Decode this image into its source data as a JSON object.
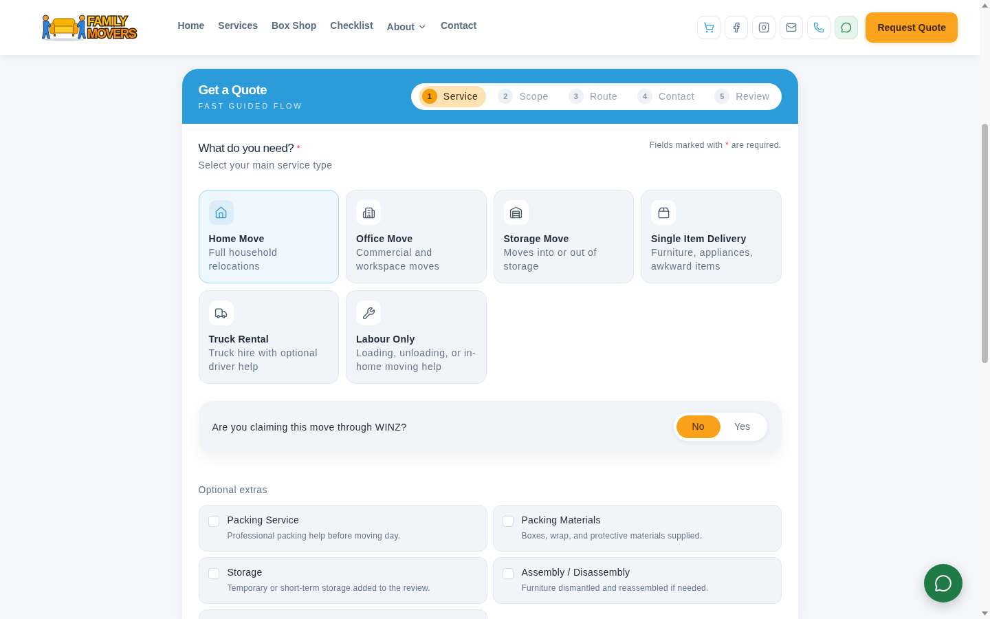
{
  "header": {
    "logo": {
      "line_1": "FAMILY",
      "line_2": "MOVERS"
    },
    "nav": [
      {
        "label": "Home",
        "kind": "link"
      },
      {
        "label": "Services",
        "kind": "link"
      },
      {
        "label": "Box Shop",
        "kind": "link"
      },
      {
        "label": "Checklist",
        "kind": "link"
      },
      {
        "label": "About",
        "kind": "dropdown"
      },
      {
        "label": "Contact",
        "kind": "link"
      }
    ],
    "cta": "Request Quote"
  },
  "quote": {
    "title": "Get a Quote",
    "subtitle": "FAST GUIDED FLOW",
    "steps": [
      {
        "number": "1",
        "label": "Service",
        "selected": true
      },
      {
        "number": "2",
        "label": "Scope",
        "selected": false
      },
      {
        "number": "3",
        "label": "Route",
        "selected": false
      },
      {
        "number": "4",
        "label": "Contact",
        "selected": false
      },
      {
        "number": "5",
        "label": "Review",
        "selected": false
      }
    ],
    "question": {
      "title": "What do you need?",
      "required_mark": "*",
      "hint": "Select your main service type"
    },
    "required_note": {
      "before": "Fields marked with",
      "mark": "*",
      "after": "are required."
    },
    "services": [
      {
        "title": "Home Move",
        "description": "Full household relocations",
        "selected": true
      },
      {
        "title": "Office Move",
        "description": "Commercial and workspace moves",
        "selected": false
      },
      {
        "title": "Storage Move",
        "description": "Moves into or out of storage",
        "selected": false
      },
      {
        "title": "Single Item Delivery",
        "description": "Furniture, appliances, awkward items",
        "selected": false
      },
      {
        "title": "Truck Rental",
        "description": "Truck hire with optional driver help",
        "selected": false
      },
      {
        "title": "Labour Only",
        "description": "Loading, unloading, or in-home moving help",
        "selected": false
      }
    ],
    "winz": {
      "question": "Are you claiming this move through WINZ?",
      "options": [
        {
          "label": "No",
          "selected": true
        },
        {
          "label": "Yes",
          "selected": false
        }
      ]
    },
    "extras": {
      "label": "Optional extras",
      "items": [
        {
          "title": "Packing Service",
          "description": "Professional packing help before moving day.",
          "checked": false
        },
        {
          "title": "Packing Materials",
          "description": "Boxes, wrap, and protective materials supplied.",
          "checked": false
        },
        {
          "title": "Storage",
          "description": "Temporary or short-term storage added to the review.",
          "checked": false
        },
        {
          "title": "Assembly / Disassembly",
          "description": "Furniture dismantled and reassembled if needed.",
          "checked": false
        }
      ]
    }
  }
}
